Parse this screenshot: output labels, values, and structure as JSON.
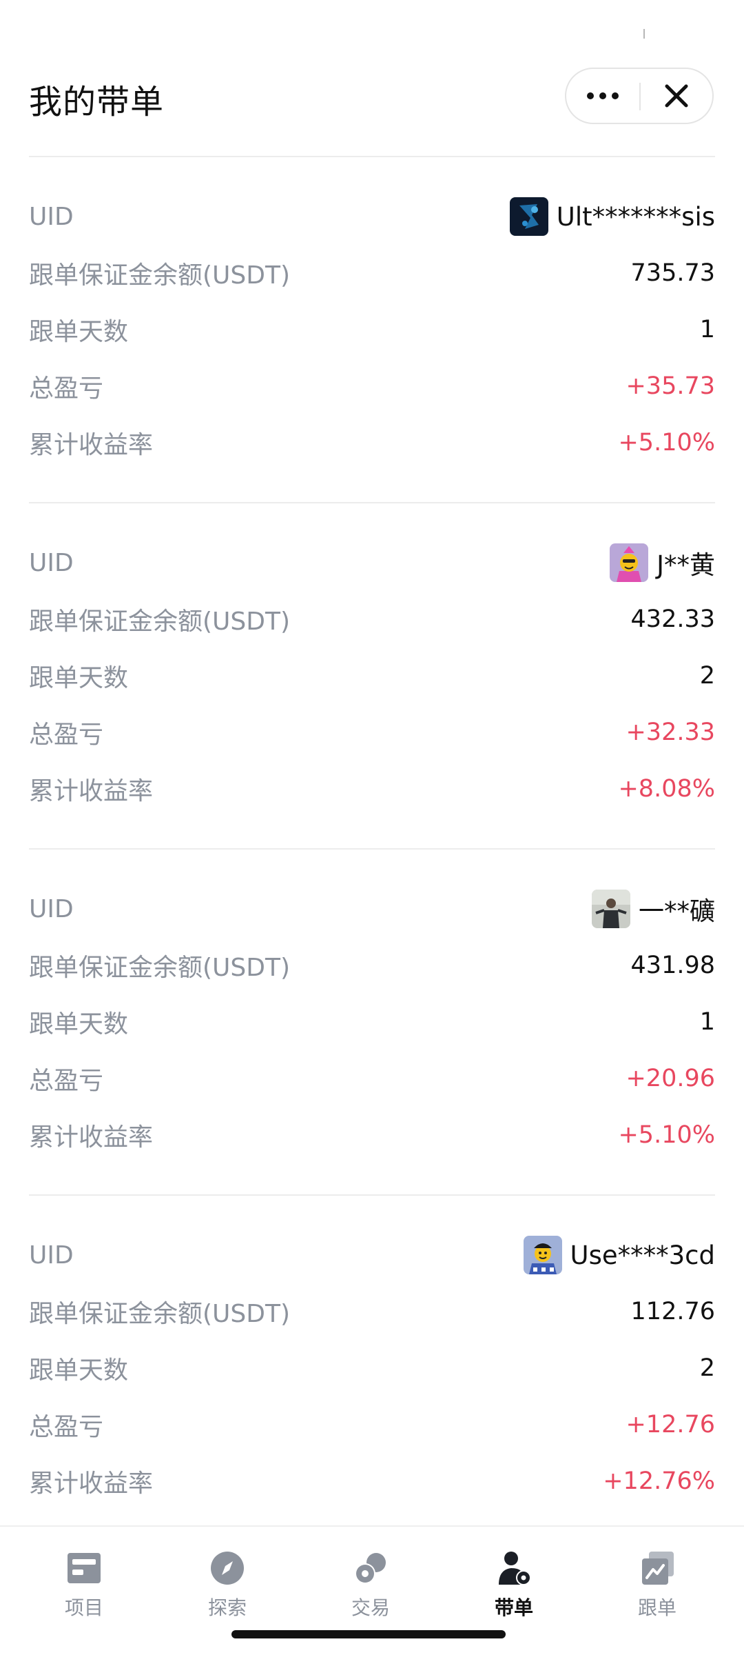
{
  "header": {
    "title": "我的带单"
  },
  "labels": {
    "uid": "UID",
    "balance": "跟单保证金余额(USDT)",
    "days": "跟单天数",
    "pnl": "总盈亏",
    "yield": "累计收益率"
  },
  "cards": [
    {
      "uid_name": "Ult*******sis",
      "balance": "735.73",
      "days": "1",
      "pnl": "+35.73",
      "yield": "+5.10%"
    },
    {
      "uid_name": "J**黄",
      "balance": "432.33",
      "days": "2",
      "pnl": "+32.33",
      "yield": "+8.08%"
    },
    {
      "uid_name": "一**礦",
      "balance": "431.98",
      "days": "1",
      "pnl": "+20.96",
      "yield": "+5.10%"
    },
    {
      "uid_name": "Use****3cd",
      "balance": "112.76",
      "days": "2",
      "pnl": "+12.76",
      "yield": "+12.76%"
    }
  ],
  "tabs": [
    {
      "label": "项目",
      "icon": "project-icon"
    },
    {
      "label": "探索",
      "icon": "compass-icon"
    },
    {
      "label": "交易",
      "icon": "trade-icon"
    },
    {
      "label": "带单",
      "icon": "lead-trade-icon"
    },
    {
      "label": "跟单",
      "icon": "copy-trade-icon"
    }
  ],
  "colors": {
    "positive": "#e8475f",
    "label": "#8c929c",
    "text": "#111111"
  }
}
